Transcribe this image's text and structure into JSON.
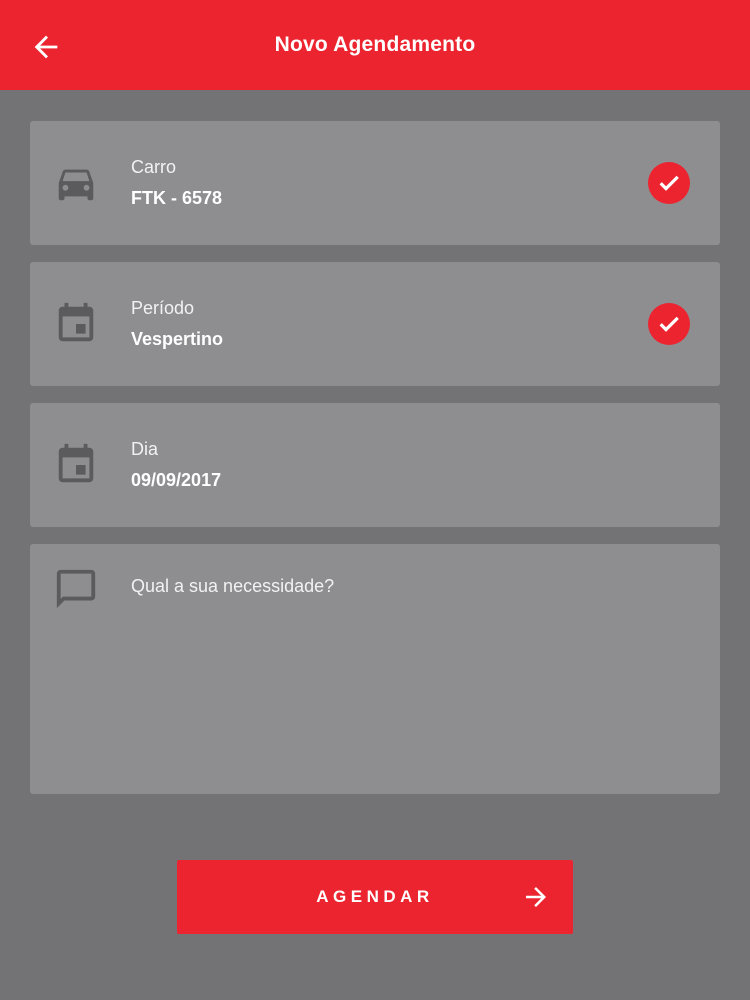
{
  "header": {
    "title": "Novo Agendamento",
    "back_icon": "arrow-left-icon"
  },
  "fields": {
    "car": {
      "label": "Carro",
      "value": "FTK - 6578",
      "icon": "car-icon",
      "selected": true
    },
    "period": {
      "label": "Período",
      "value": "Vespertino",
      "icon": "calendar-icon",
      "selected": true
    },
    "day": {
      "label": "Dia",
      "value": "09/09/2017",
      "icon": "calendar-icon"
    },
    "need": {
      "placeholder": "Qual a sua necessidade?",
      "icon": "comment-icon"
    }
  },
  "submit": {
    "label": "AGENDAR",
    "icon": "arrow-right-icon"
  },
  "colors": {
    "accent": "#ec2430",
    "background": "#737375",
    "card": "#8e8e91"
  }
}
